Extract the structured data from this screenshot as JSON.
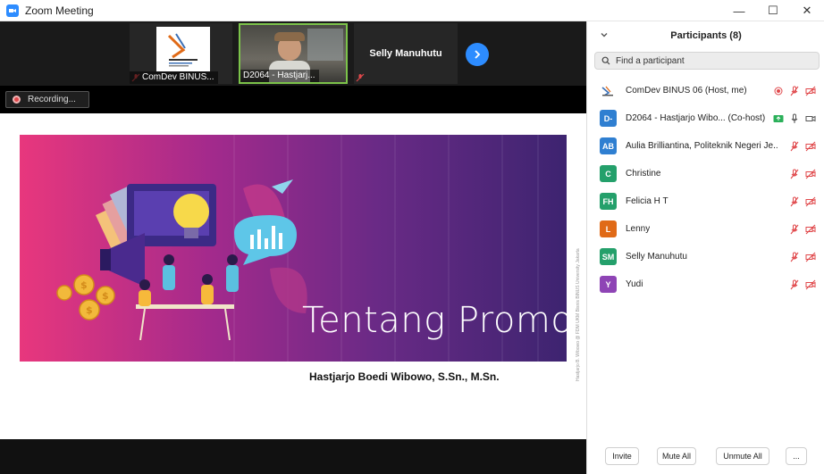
{
  "window": {
    "title": "Zoom Meeting"
  },
  "video_strip": {
    "tiles": [
      {
        "name": "ComDev BINUS..."
      },
      {
        "name": "D2064 - Hastjarj..."
      },
      {
        "name": "Selly Manuhutu"
      }
    ]
  },
  "recording": {
    "label": "Recording..."
  },
  "slide": {
    "title": "Tentang Promosi",
    "author": "Hastjarjo Boedi Wibowo, S.Sn., M.Sn.",
    "side_credit": "Hastjarjo B. Wibowo @ FDM UKM Bisnis BINUS University Jakarta"
  },
  "panel": {
    "title": "Participants (8)",
    "search_placeholder": "Find a participant",
    "participants": [
      {
        "initials": "",
        "name": "ComDev BINUS 06 (Host, me)",
        "color": "#ffffff"
      },
      {
        "initials": "D-",
        "name": "D2064 - Hastjarjo Wibo... (Co-host)",
        "color": "#2f7fd1"
      },
      {
        "initials": "AB",
        "name": "Aulia Brilliantina, Politeknik Negeri Je...",
        "color": "#2f7fd1"
      },
      {
        "initials": "C",
        "name": "Christine",
        "color": "#24a06b"
      },
      {
        "initials": "FH",
        "name": "Felicia H T",
        "color": "#24a06b"
      },
      {
        "initials": "L",
        "name": "Lenny",
        "color": "#e06a17"
      },
      {
        "initials": "SM",
        "name": "Selly Manuhutu",
        "color": "#24a06b"
      },
      {
        "initials": "Y",
        "name": "Yudi",
        "color": "#8e44b5"
      }
    ],
    "buttons": {
      "invite": "Invite",
      "mute_all": "Mute All",
      "unmute_all": "Unmute All",
      "more": "..."
    }
  },
  "colors": {
    "accent": "#2d8cff",
    "muted_red": "#e0484b"
  }
}
